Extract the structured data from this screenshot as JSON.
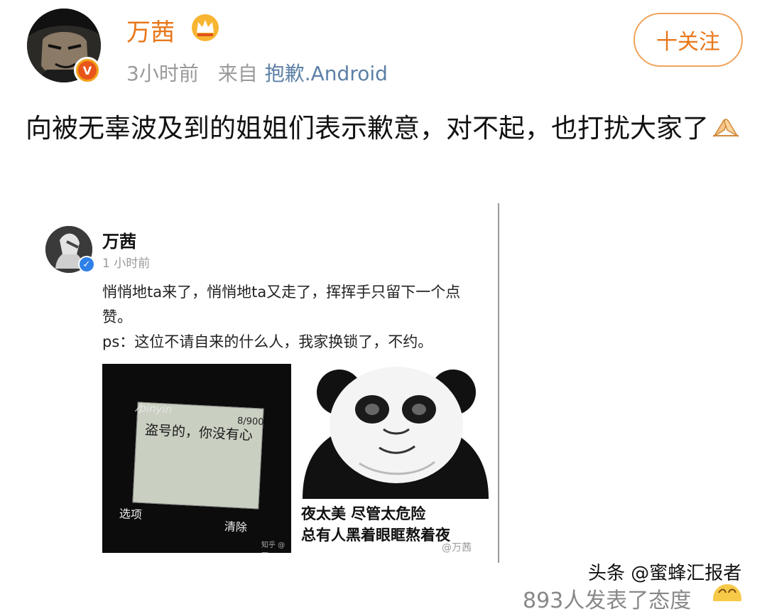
{
  "post": {
    "username": "万茜",
    "time": "3小时前",
    "from_label": "来自",
    "source": "抱歉.Android",
    "follow_label": "十关注",
    "text": "向被无辜波及到的姐姐们表示歉意，对不起，也打扰大家了",
    "colors": {
      "name": "#e8771a",
      "source": "#5c7fa6",
      "follow_border": "#f0a35c"
    }
  },
  "embed": {
    "username": "万茜",
    "time": "1 小时前",
    "text_lines": [
      "悄悄地ta来了，悄悄地ta又走了，挥挥手只留下一个点赞。",
      "ps：这位不请自来的什么人，我家换锁了，不约。"
    ],
    "phone": {
      "brand": "⁄pinyin",
      "count": "8/900",
      "message": "盗号的，你没有心",
      "left_soft": "选项",
      "right_soft": "清除",
      "watermark": "知乎 @万"
    },
    "panda": {
      "caption_line1": "夜太美 尽管太危险",
      "caption_line2": "总有人黑着眼眶熬着夜",
      "watermark": "@万茜"
    }
  },
  "footer": {
    "watermark": "头条 @蜜蜂汇报者",
    "partial_text": "893人发表了态度"
  }
}
